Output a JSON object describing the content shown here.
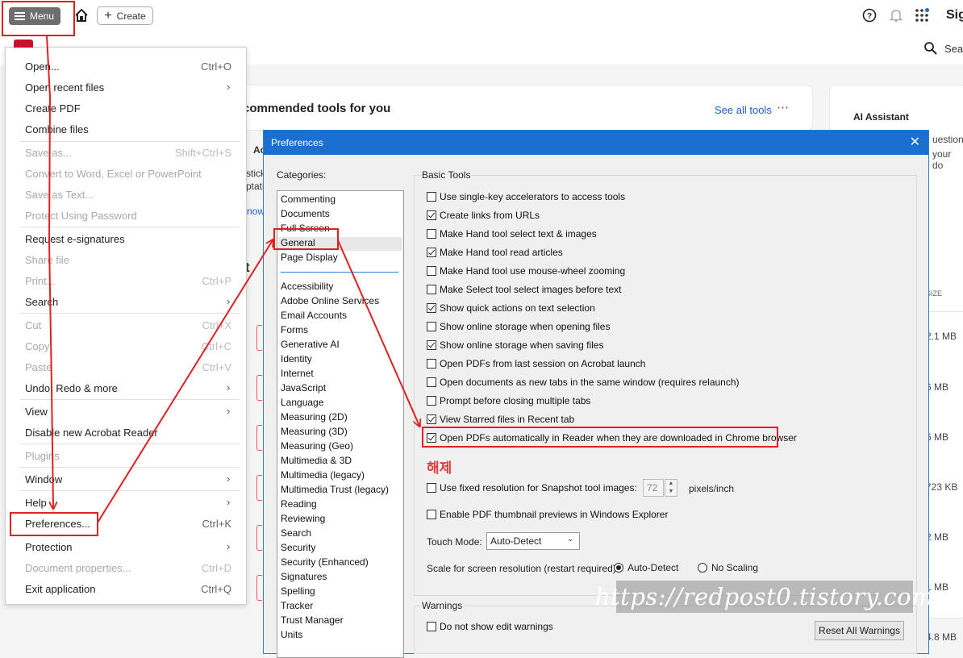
{
  "topbar": {
    "menu_label": "Menu",
    "create_label": "Create",
    "sign_text": "Sig",
    "search_label": "Sear"
  },
  "background": {
    "recommended_title": "commended tools for you",
    "see_all": "See all tools",
    "see_all_more": "⋯",
    "ai_title": "AI Assistant",
    "ai_line1": "uestions",
    "ai_line2": "your do",
    "frag_ac": "Ac",
    "frag_stick": "stick",
    "frag_ptati": "ptati",
    "frag_now": "now",
    "frag_t": "t",
    "size_header": "SIZE",
    "sizes": [
      "2.1 MB",
      "6 MB",
      "6 MB",
      "723 KB",
      "2 MB",
      "1 MB",
      "4.8 MB"
    ]
  },
  "menu": {
    "items": [
      {
        "label": "Open...",
        "shortcut": "Ctrl+O",
        "disabled": false
      },
      {
        "label": "Open recent files",
        "submenu": true,
        "disabled": false
      },
      {
        "label": "Create PDF",
        "disabled": false
      },
      {
        "label": "Combine files",
        "disabled": false
      },
      {
        "label": "Save as...",
        "shortcut": "Shift+Ctrl+S",
        "disabled": true
      },
      {
        "label": "Convert to Word, Excel or PowerPoint",
        "disabled": true
      },
      {
        "label": "Save as Text...",
        "disabled": true
      },
      {
        "label": "Protect Using Password",
        "disabled": true
      },
      {
        "label": "Request e-signatures",
        "disabled": false
      },
      {
        "label": "Share file",
        "disabled": true
      },
      {
        "label": "Print...",
        "shortcut": "Ctrl+P",
        "disabled": true
      },
      {
        "label": "Search",
        "submenu": true,
        "disabled": false
      },
      {
        "label": "Cut",
        "shortcut": "Ctrl+X",
        "disabled": true
      },
      {
        "label": "Copy",
        "shortcut": "Ctrl+C",
        "disabled": true
      },
      {
        "label": "Paste",
        "shortcut": "Ctrl+V",
        "disabled": true
      },
      {
        "label": "Undo, Redo & more",
        "submenu": true,
        "disabled": false
      },
      {
        "label": "View",
        "submenu": true,
        "disabled": false
      },
      {
        "label": "Disable new Acrobat Reader",
        "disabled": false
      },
      {
        "label": "Plugins",
        "disabled": true
      },
      {
        "label": "Window",
        "submenu": true,
        "disabled": false
      },
      {
        "label": "Help",
        "submenu": true,
        "disabled": false
      },
      {
        "label": "Preferences...",
        "shortcut": "Ctrl+K",
        "disabled": false
      },
      {
        "label": "Protection",
        "submenu": true,
        "disabled": false
      },
      {
        "label": "Document properties...",
        "shortcut": "Ctrl+D",
        "disabled": true
      },
      {
        "label": "Exit application",
        "shortcut": "Ctrl+Q",
        "disabled": false
      }
    ]
  },
  "prefs": {
    "title": "Preferences",
    "close_glyph": "✕",
    "categories_label": "Categories:",
    "categories_top": [
      "Commenting",
      "Documents",
      "Full Screen",
      "General",
      "Page Display"
    ],
    "categories": [
      "Accessibility",
      "Adobe Online Services",
      "Email Accounts",
      "Forms",
      "Generative AI",
      "Identity",
      "Internet",
      "JavaScript",
      "Language",
      "Measuring (2D)",
      "Measuring (3D)",
      "Measuring (Geo)",
      "Multimedia & 3D",
      "Multimedia (legacy)",
      "Multimedia Trust (legacy)",
      "Reading",
      "Reviewing",
      "Search",
      "Security",
      "Security (Enhanced)",
      "Signatures",
      "Spelling",
      "Tracker",
      "Trust Manager",
      "Units"
    ],
    "selected_category": "General",
    "group_label": "Basic Tools",
    "options": [
      {
        "label": "Use single-key accelerators to access tools",
        "checked": false
      },
      {
        "label": "Create links from URLs",
        "checked": true
      },
      {
        "label": "Make Hand tool select text & images",
        "checked": false
      },
      {
        "label": "Make Hand tool read articles",
        "checked": true
      },
      {
        "label": "Make Hand tool use mouse-wheel zooming",
        "checked": false
      },
      {
        "label": "Make Select tool select images before text",
        "checked": false
      },
      {
        "label": "Show quick actions on text selection",
        "checked": true
      },
      {
        "label": "Show online storage when opening files",
        "checked": false
      },
      {
        "label": "Show online storage when saving files",
        "checked": true
      },
      {
        "label": "Open PDFs from last session on Acrobat launch",
        "checked": false
      },
      {
        "label": "Open documents as new tabs in the same window (requires relaunch)",
        "checked": false
      },
      {
        "label": "Prompt before closing multiple tabs",
        "checked": false
      },
      {
        "label": "View Starred files in Recent tab",
        "checked": true
      },
      {
        "label": "Open PDFs automatically in Reader when they are downloaded in Chrome browser",
        "checked": true
      }
    ],
    "annotation": "해제",
    "snapshot_label": "Use fixed resolution for Snapshot tool images:",
    "snapshot_checked": false,
    "snapshot_value": "72",
    "snapshot_unit": "pixels/inch",
    "thumbnail_label": "Enable PDF thumbnail previews in Windows Explorer",
    "thumbnail_checked": false,
    "touch_label": "Touch Mode:",
    "touch_value": "Auto-Detect",
    "scale_label": "Scale for screen resolution (restart required):",
    "scale_options": [
      {
        "label": "Auto-Detect",
        "selected": true
      },
      {
        "label": "No Scaling",
        "selected": false
      }
    ],
    "warnings_label": "Warnings",
    "no_edit_warnings_label": "Do not show edit warnings",
    "no_edit_warnings_checked": false,
    "reset_label": "Reset All Warnings"
  },
  "watermark": "https://redpost0.tistory.com",
  "colors": {
    "highlight_red": "#e02020",
    "titlebar_blue": "#1b6fd1",
    "link_blue": "#1a5fc7"
  }
}
